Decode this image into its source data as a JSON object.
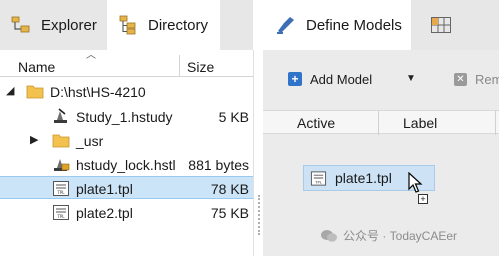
{
  "left": {
    "tabs": {
      "explorer": "Explorer",
      "directory": "Directory"
    },
    "columns": {
      "name": "Name",
      "size": "Size"
    },
    "rows": [
      {
        "name": "D:\\hst\\HS-4210",
        "size": "",
        "icon": "folder-icon"
      },
      {
        "name": "Study_1.hstudy",
        "size": "5 KB",
        "icon": "study-icon"
      },
      {
        "name": "_usr",
        "size": "",
        "icon": "folder-icon"
      },
      {
        "name": "hstudy_lock.hstl",
        "size": "881 bytes",
        "icon": "lock-file-icon"
      },
      {
        "name": "plate1.tpl",
        "size": "78 KB",
        "icon": "tpl-file-icon"
      },
      {
        "name": "plate2.tpl",
        "size": "75 KB",
        "icon": "tpl-file-icon"
      }
    ]
  },
  "right": {
    "tabs": {
      "models": "Define Models"
    },
    "toolbar": {
      "add": "Add Model",
      "remove": "Rem"
    },
    "columns": {
      "active": "Active",
      "label": "Label"
    },
    "drag_item": "plate1.tpl"
  },
  "watermark": "公众号 · TodayCAEer",
  "colors": {
    "selection": "#cce4f7",
    "accent": "#2f74c8",
    "folder": "#f2c14e"
  }
}
